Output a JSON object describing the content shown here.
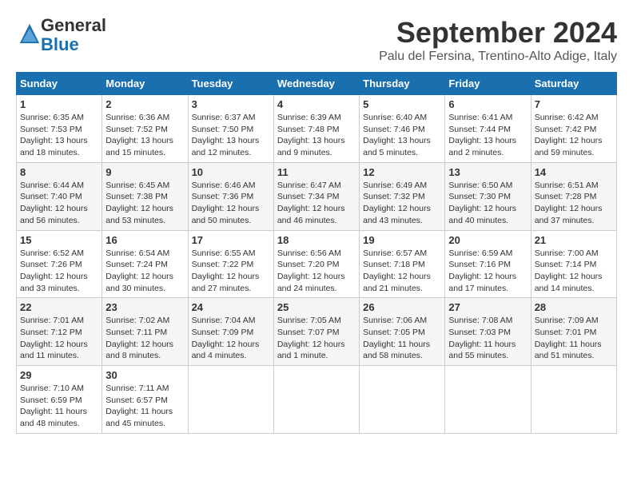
{
  "logo": {
    "general": "General",
    "blue": "Blue"
  },
  "title": "September 2024",
  "location": "Palu del Fersina, Trentino-Alto Adige, Italy",
  "days_of_week": [
    "Sunday",
    "Monday",
    "Tuesday",
    "Wednesday",
    "Thursday",
    "Friday",
    "Saturday"
  ],
  "weeks": [
    [
      {
        "day": "1",
        "info": "Sunrise: 6:35 AM\nSunset: 7:53 PM\nDaylight: 13 hours and 18 minutes."
      },
      {
        "day": "2",
        "info": "Sunrise: 6:36 AM\nSunset: 7:52 PM\nDaylight: 13 hours and 15 minutes."
      },
      {
        "day": "3",
        "info": "Sunrise: 6:37 AM\nSunset: 7:50 PM\nDaylight: 13 hours and 12 minutes."
      },
      {
        "day": "4",
        "info": "Sunrise: 6:39 AM\nSunset: 7:48 PM\nDaylight: 13 hours and 9 minutes."
      },
      {
        "day": "5",
        "info": "Sunrise: 6:40 AM\nSunset: 7:46 PM\nDaylight: 13 hours and 5 minutes."
      },
      {
        "day": "6",
        "info": "Sunrise: 6:41 AM\nSunset: 7:44 PM\nDaylight: 13 hours and 2 minutes."
      },
      {
        "day": "7",
        "info": "Sunrise: 6:42 AM\nSunset: 7:42 PM\nDaylight: 12 hours and 59 minutes."
      }
    ],
    [
      {
        "day": "8",
        "info": "Sunrise: 6:44 AM\nSunset: 7:40 PM\nDaylight: 12 hours and 56 minutes."
      },
      {
        "day": "9",
        "info": "Sunrise: 6:45 AM\nSunset: 7:38 PM\nDaylight: 12 hours and 53 minutes."
      },
      {
        "day": "10",
        "info": "Sunrise: 6:46 AM\nSunset: 7:36 PM\nDaylight: 12 hours and 50 minutes."
      },
      {
        "day": "11",
        "info": "Sunrise: 6:47 AM\nSunset: 7:34 PM\nDaylight: 12 hours and 46 minutes."
      },
      {
        "day": "12",
        "info": "Sunrise: 6:49 AM\nSunset: 7:32 PM\nDaylight: 12 hours and 43 minutes."
      },
      {
        "day": "13",
        "info": "Sunrise: 6:50 AM\nSunset: 7:30 PM\nDaylight: 12 hours and 40 minutes."
      },
      {
        "day": "14",
        "info": "Sunrise: 6:51 AM\nSunset: 7:28 PM\nDaylight: 12 hours and 37 minutes."
      }
    ],
    [
      {
        "day": "15",
        "info": "Sunrise: 6:52 AM\nSunset: 7:26 PM\nDaylight: 12 hours and 33 minutes."
      },
      {
        "day": "16",
        "info": "Sunrise: 6:54 AM\nSunset: 7:24 PM\nDaylight: 12 hours and 30 minutes."
      },
      {
        "day": "17",
        "info": "Sunrise: 6:55 AM\nSunset: 7:22 PM\nDaylight: 12 hours and 27 minutes."
      },
      {
        "day": "18",
        "info": "Sunrise: 6:56 AM\nSunset: 7:20 PM\nDaylight: 12 hours and 24 minutes."
      },
      {
        "day": "19",
        "info": "Sunrise: 6:57 AM\nSunset: 7:18 PM\nDaylight: 12 hours and 21 minutes."
      },
      {
        "day": "20",
        "info": "Sunrise: 6:59 AM\nSunset: 7:16 PM\nDaylight: 12 hours and 17 minutes."
      },
      {
        "day": "21",
        "info": "Sunrise: 7:00 AM\nSunset: 7:14 PM\nDaylight: 12 hours and 14 minutes."
      }
    ],
    [
      {
        "day": "22",
        "info": "Sunrise: 7:01 AM\nSunset: 7:12 PM\nDaylight: 12 hours and 11 minutes."
      },
      {
        "day": "23",
        "info": "Sunrise: 7:02 AM\nSunset: 7:11 PM\nDaylight: 12 hours and 8 minutes."
      },
      {
        "day": "24",
        "info": "Sunrise: 7:04 AM\nSunset: 7:09 PM\nDaylight: 12 hours and 4 minutes."
      },
      {
        "day": "25",
        "info": "Sunrise: 7:05 AM\nSunset: 7:07 PM\nDaylight: 12 hours and 1 minute."
      },
      {
        "day": "26",
        "info": "Sunrise: 7:06 AM\nSunset: 7:05 PM\nDaylight: 11 hours and 58 minutes."
      },
      {
        "day": "27",
        "info": "Sunrise: 7:08 AM\nSunset: 7:03 PM\nDaylight: 11 hours and 55 minutes."
      },
      {
        "day": "28",
        "info": "Sunrise: 7:09 AM\nSunset: 7:01 PM\nDaylight: 11 hours and 51 minutes."
      }
    ],
    [
      {
        "day": "29",
        "info": "Sunrise: 7:10 AM\nSunset: 6:59 PM\nDaylight: 11 hours and 48 minutes."
      },
      {
        "day": "30",
        "info": "Sunrise: 7:11 AM\nSunset: 6:57 PM\nDaylight: 11 hours and 45 minutes."
      },
      null,
      null,
      null,
      null,
      null
    ]
  ]
}
